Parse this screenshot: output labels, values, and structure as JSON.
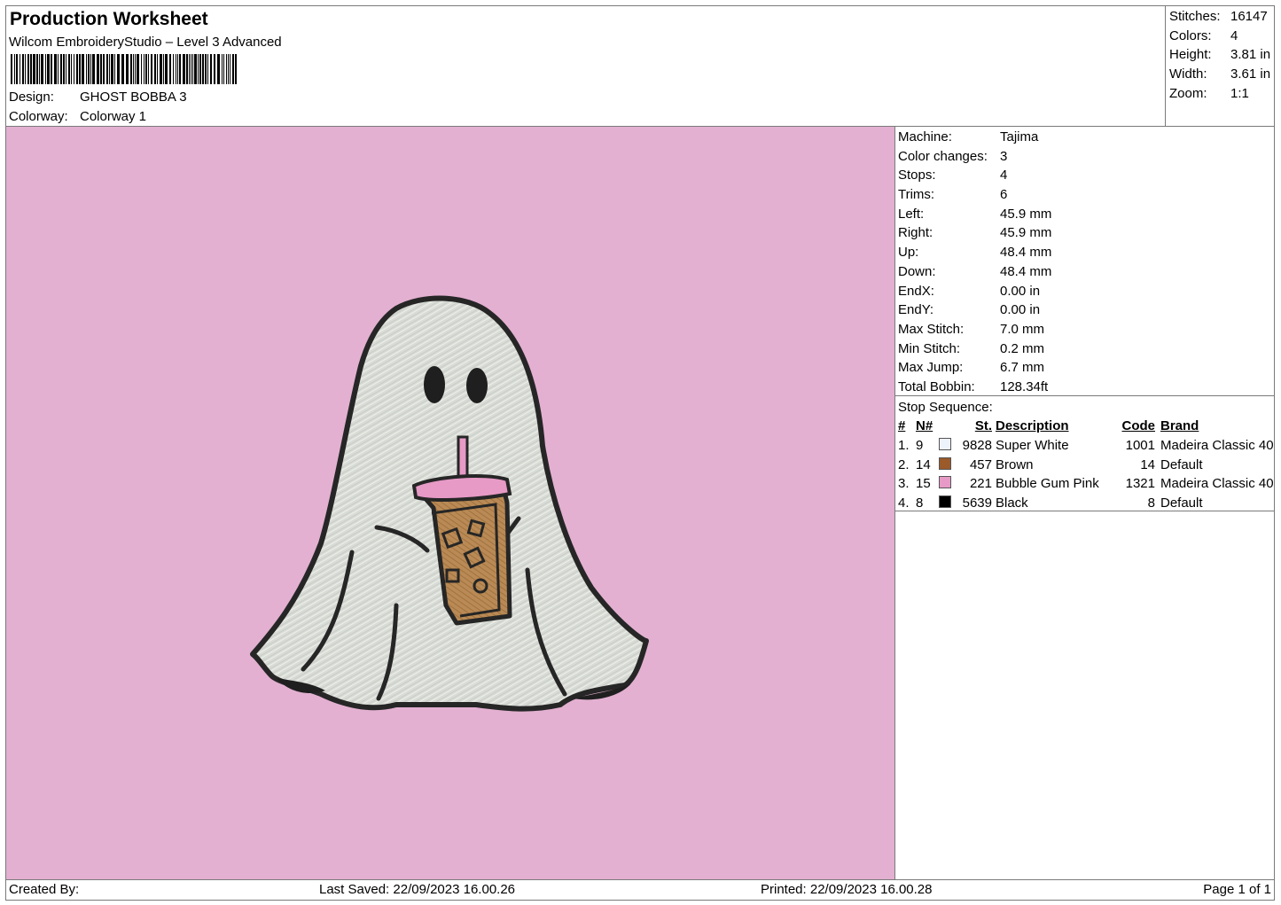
{
  "header": {
    "title": "Production Worksheet",
    "software": "Wilcom EmbroideryStudio – Level 3 Advanced",
    "design_label": "Design:",
    "design_value": "GHOST BOBBA 3",
    "colorway_label": "Colorway:",
    "colorway_value": "Colorway 1"
  },
  "summary": [
    {
      "label": "Stitches:",
      "value": "16147"
    },
    {
      "label": "Colors:",
      "value": "4"
    },
    {
      "label": "Height:",
      "value": "3.81 in"
    },
    {
      "label": "Width:",
      "value": "3.61 in"
    },
    {
      "label": "Zoom:",
      "value": "1:1"
    }
  ],
  "machine_info": [
    {
      "label": "Machine:",
      "value": "Tajima"
    },
    {
      "label": "Color changes:",
      "value": "3"
    },
    {
      "label": "Stops:",
      "value": "4"
    },
    {
      "label": "Trims:",
      "value": "6"
    },
    {
      "label": "Left:",
      "value": "45.9 mm"
    },
    {
      "label": "Right:",
      "value": "45.9 mm"
    },
    {
      "label": "Up:",
      "value": "48.4 mm"
    },
    {
      "label": "Down:",
      "value": "48.4 mm"
    },
    {
      "label": "EndX:",
      "value": "0.00 in"
    },
    {
      "label": "EndY:",
      "value": "0.00 in"
    },
    {
      "label": "Max Stitch:",
      "value": "7.0 mm"
    },
    {
      "label": "Min Stitch:",
      "value": "0.2 mm"
    },
    {
      "label": "Max Jump:",
      "value": "6.7 mm"
    },
    {
      "label": "Total Bobbin:",
      "value": "128.34ft"
    }
  ],
  "stop_sequence": {
    "label": "Stop Sequence:",
    "headers": {
      "idx": "#",
      "n": "N#",
      "st": "St.",
      "desc": "Description",
      "code": "Code",
      "brand": "Brand"
    },
    "rows": [
      {
        "idx": "1.",
        "n": "9",
        "color": "#eef2fb",
        "st": "9828",
        "desc": "Super White",
        "code": "1001",
        "brand": "Madeira Classic 40"
      },
      {
        "idx": "2.",
        "n": "14",
        "color": "#9a5a2a",
        "st": "457",
        "desc": "Brown",
        "code": "14",
        "brand": "Default"
      },
      {
        "idx": "3.",
        "n": "15",
        "color": "#e79ac6",
        "st": "221",
        "desc": "Bubble Gum Pink",
        "code": "1321",
        "brand": "Madeira Classic 40"
      },
      {
        "idx": "4.",
        "n": "8",
        "color": "#000000",
        "st": "5639",
        "desc": "Black",
        "code": "8",
        "brand": "Default"
      }
    ]
  },
  "preview": {
    "background": "#e3b0d1"
  },
  "footer": {
    "created_by": "Created By:",
    "last_saved": "Last Saved: 22/09/2023 16.00.26",
    "printed": "Printed: 22/09/2023 16.00.28",
    "page": "Page 1 of 1"
  }
}
